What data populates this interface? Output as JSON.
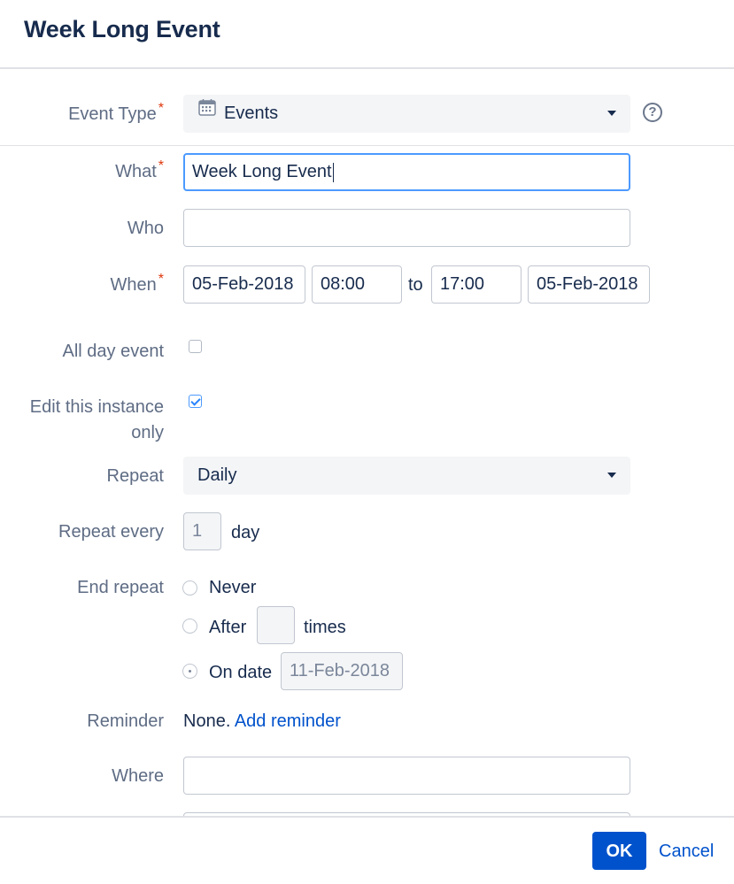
{
  "dialog": {
    "title": "Week Long Event"
  },
  "form": {
    "event_type": {
      "label": "Event Type",
      "value": "Events",
      "icon": "calendar-icon"
    },
    "what": {
      "label": "What",
      "value": "Week Long Event"
    },
    "who": {
      "label": "Who",
      "value": ""
    },
    "when": {
      "label": "When",
      "start_date": "05-Feb-2018",
      "start_time": "08:00",
      "to_label": "to",
      "end_time": "17:00",
      "end_date": "05-Feb-2018"
    },
    "all_day": {
      "label": "All day event",
      "checked": false
    },
    "edit_instance": {
      "label_line1": "Edit this instance",
      "label_line2": "only",
      "checked": true
    },
    "repeat": {
      "label": "Repeat",
      "value": "Daily"
    },
    "repeat_every": {
      "label": "Repeat every",
      "value": "1",
      "unit": "day"
    },
    "end_repeat": {
      "label": "End repeat",
      "never_label": "Never",
      "after_label": "After",
      "after_value": "",
      "times_label": "times",
      "on_date_label": "On date",
      "on_date_value": "11-Feb-2018",
      "selected": "on_date"
    },
    "reminder": {
      "label": "Reminder",
      "value": "None.",
      "add_link": "Add reminder"
    },
    "where": {
      "label": "Where",
      "value": ""
    }
  },
  "footer": {
    "ok_label": "OK",
    "cancel_label": "Cancel"
  },
  "colors": {
    "primary": "#0052cc",
    "required": "#de350b",
    "focus": "#4c9aff"
  }
}
